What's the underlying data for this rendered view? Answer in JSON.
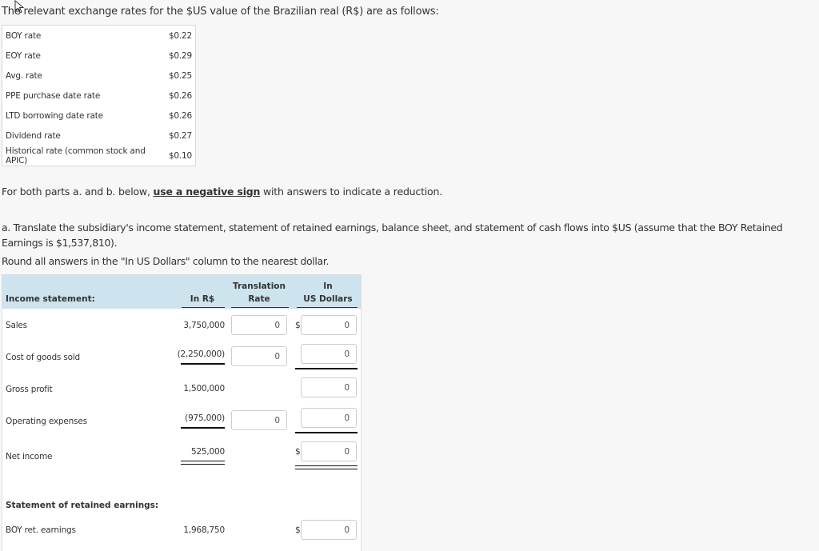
{
  "intro": "The relevant exchange rates for the $US value of the Brazilian real (R$) are as follows:",
  "rates": [
    {
      "label": "BOY rate",
      "value": "$0.22"
    },
    {
      "label": "EOY rate",
      "value": "$0.29"
    },
    {
      "label": "Avg. rate",
      "value": "$0.25"
    },
    {
      "label": "PPE purchase date rate",
      "value": "$0.26"
    },
    {
      "label": "LTD borrowing date rate",
      "value": "$0.26"
    },
    {
      "label": "Dividend rate",
      "value": "$0.27"
    },
    {
      "label": "Historical rate (common stock and APIC)",
      "value": "$0.10"
    }
  ],
  "note": {
    "prefix": "For both parts a. and b. below, ",
    "bold": "use a negative sign",
    "suffix": " with answers to indicate a reduction."
  },
  "part_a": "a. Translate the subsidiary's income statement, statement of retained earnings, balance sheet, and statement of cash flows into $US (assume that the BOY Retained Earnings is $1,537,810).",
  "round_note": "Round all answers in the \"In US Dollars\" column to the nearest dollar.",
  "table": {
    "header": {
      "section": "Income statement:",
      "col_rs": "In R$",
      "col_rate_1": "Translation",
      "col_rate_2": "Rate",
      "col_usd_1": "In",
      "col_usd_2": "US Dollars"
    },
    "currency_symbol": "$",
    "rows": [
      {
        "label": "Sales",
        "rs": "3,750,000",
        "rate": "0",
        "usd": "0"
      },
      {
        "label": "Cost of goods sold",
        "rs": "(2,250,000)",
        "rate": "0",
        "usd": "0"
      },
      {
        "label": "Gross profit",
        "rs": "1,500,000",
        "usd": "0"
      },
      {
        "label": "Operating expenses",
        "rs": "(975,000)",
        "rate": "0",
        "usd": "0"
      },
      {
        "label": "Net income",
        "rs": "525,000",
        "usd": "0"
      }
    ],
    "retained": {
      "section": "Statement of retained earnings:",
      "rows": [
        {
          "label": "BOY ret. earnings",
          "rs": "1,968,750",
          "usd": "0"
        }
      ]
    }
  }
}
